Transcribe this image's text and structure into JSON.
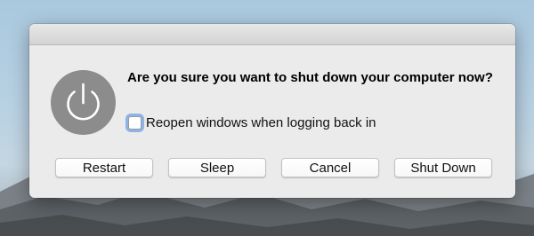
{
  "dialog": {
    "message": "Are you sure you want to shut down your computer now?",
    "reopen_checkbox": {
      "label": "Reopen windows when logging back in",
      "checked": false
    },
    "icon": "power-icon"
  },
  "buttons": {
    "restart": "Restart",
    "sleep": "Sleep",
    "cancel": "Cancel",
    "shut_down": "Shut Down"
  }
}
